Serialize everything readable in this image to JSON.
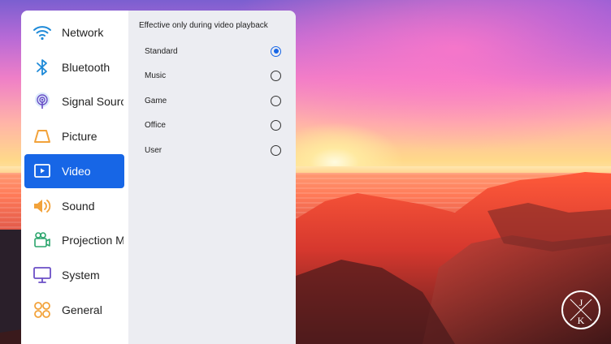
{
  "menu": {
    "items": [
      {
        "label": "Network",
        "icon": "wifi-icon",
        "active": false
      },
      {
        "label": "Bluetooth",
        "icon": "bluetooth-icon",
        "active": false
      },
      {
        "label": "Signal Source",
        "icon": "signal-source-icon",
        "active": false
      },
      {
        "label": "Picture",
        "icon": "picture-icon",
        "active": false
      },
      {
        "label": "Video",
        "icon": "video-icon",
        "active": true
      },
      {
        "label": "Sound",
        "icon": "speaker-icon",
        "active": false
      },
      {
        "label": "Projection Mode",
        "icon": "projector-icon",
        "active": false
      },
      {
        "label": "System",
        "icon": "monitor-icon",
        "active": false
      },
      {
        "label": "General",
        "icon": "general-icon",
        "active": false
      }
    ]
  },
  "panel": {
    "title": "Effective only during video playback",
    "options": [
      {
        "label": "Standard",
        "selected": true
      },
      {
        "label": "Music",
        "selected": false
      },
      {
        "label": "Game",
        "selected": false
      },
      {
        "label": "Office",
        "selected": false
      },
      {
        "label": "User",
        "selected": false
      }
    ]
  },
  "logo": {
    "letters": "JK"
  },
  "colors": {
    "accent": "#1766e6",
    "icon_blue": "#1e8ad8",
    "icon_orange": "#f2a23a",
    "icon_green": "#2aa56c",
    "icon_purple": "#6b4fc6"
  }
}
